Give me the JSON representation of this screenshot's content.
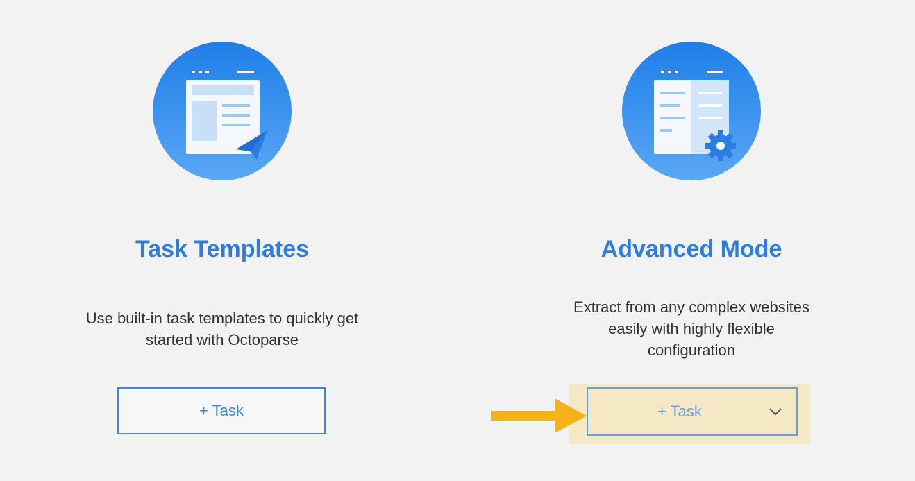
{
  "cards": [
    {
      "title": "Task Templates",
      "description_lines": [
        "Use built-in task templates to quickly get",
        "started with Octoparse"
      ],
      "button_label": "+ Task",
      "icon": "template-paper-plane-icon"
    },
    {
      "title": "Advanced Mode",
      "description_lines": [
        "Extract from any complex websites",
        "easily with highly flexible",
        "configuration"
      ],
      "button_label": "+ Task",
      "icon": "advanced-gear-icon",
      "dropdown_icon": "chevron-down-icon"
    }
  ],
  "colors": {
    "accent": "#2a7de1",
    "highlight": "#f4e9c4",
    "arrow": "#f5b21a",
    "background": "#f2f2f2"
  }
}
